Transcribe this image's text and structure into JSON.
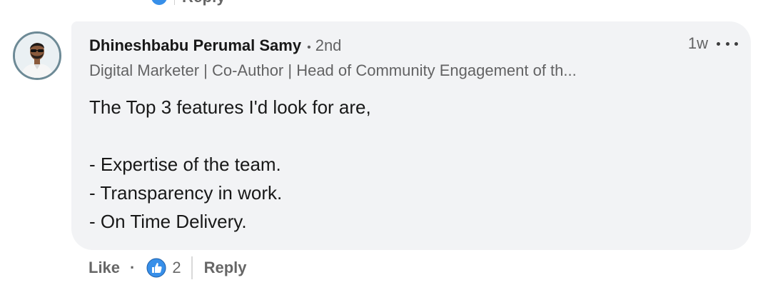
{
  "previous_comment": {
    "reply_label": "Reply"
  },
  "comment": {
    "author_name": "Dhineshbabu Perumal Samy",
    "separator": "•",
    "connection_degree": "2nd",
    "headline": "Digital Marketer | Co-Author | Head of Community Engagement of th...",
    "timestamp": "1w",
    "more_icon": "ellipsis-icon",
    "body_lines": [
      "The Top 3 features I'd look for are,",
      "",
      "- Expertise of the team.",
      "- Transparency in work.",
      "- On Time Delivery."
    ]
  },
  "actions": {
    "like_label": "Like",
    "dot": "·",
    "reaction_icon": "like-reaction-icon",
    "reaction_count": "2",
    "reply_label": "Reply"
  },
  "colors": {
    "bubble_bg": "#f2f3f5",
    "like_blue": "#378fe9",
    "secondary_text": "#666666"
  }
}
